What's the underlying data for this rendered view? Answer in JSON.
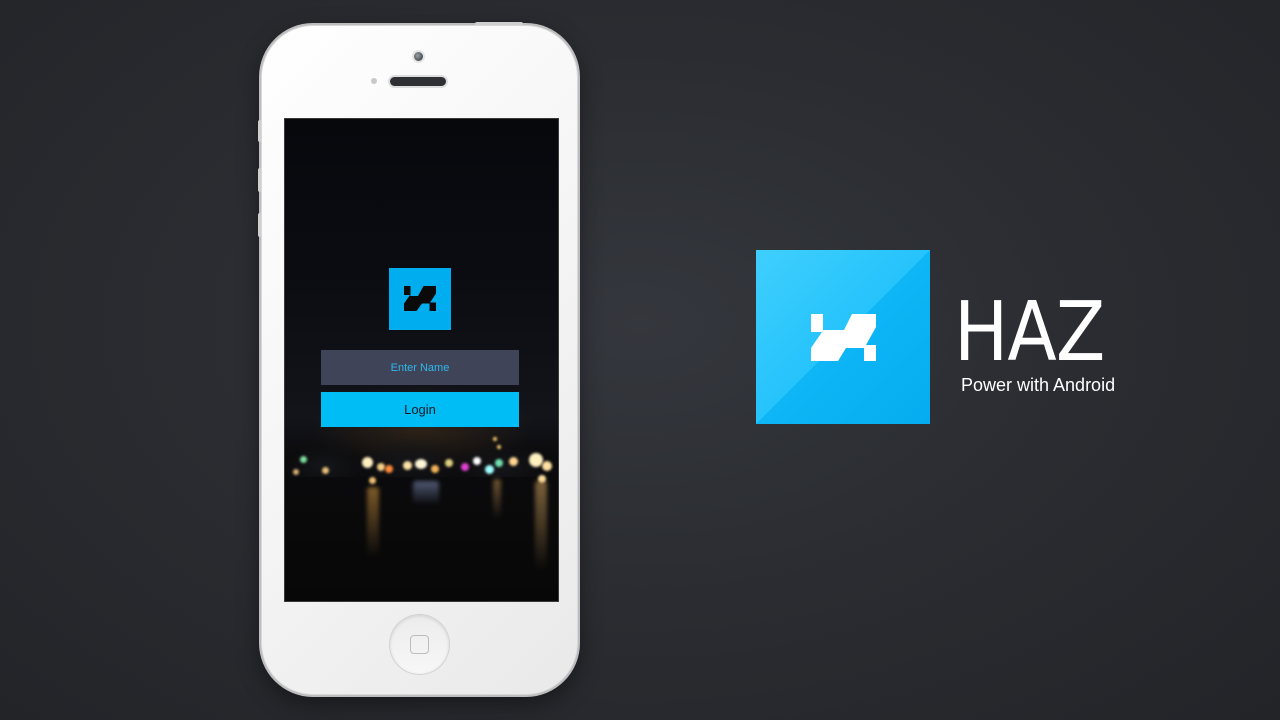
{
  "login_screen": {
    "name_placeholder": "Enter Name",
    "login_label": "Login"
  },
  "brand": {
    "title": "HAZ",
    "tagline": "Power with Android"
  },
  "colors": {
    "accent": "#00BEF5",
    "input_background": "#404458",
    "placeholder_text": "#2FB6EF",
    "page_background": "#2B2D32"
  },
  "icons": {
    "app_logo": "haz-logo-icon",
    "home_button": "home-square-icon"
  }
}
